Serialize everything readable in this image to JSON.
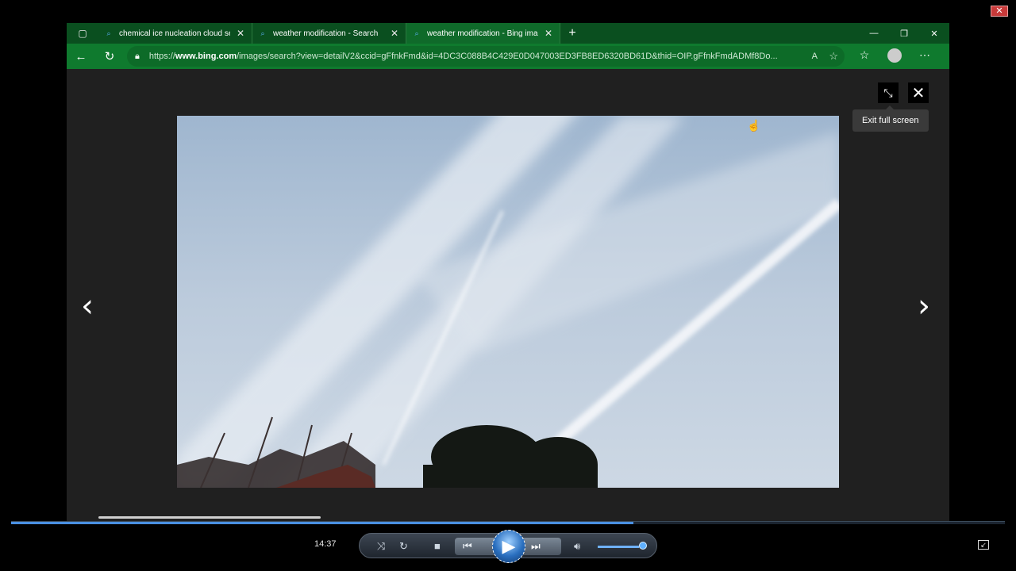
{
  "browser": {
    "tabs": [
      {
        "title": "chemical ice nucleation cloud se",
        "active": false
      },
      {
        "title": "weather modification - Search",
        "active": false
      },
      {
        "title": "weather modification - Bing ima",
        "active": true
      }
    ],
    "url_prefix": "https://",
    "url_domain": "www.bing.com",
    "url_rest": "/images/search?view=detailV2&ccid=gFfnkFmd&id=4DC3C088B4C429E0D047003ED3FB8ED6320BD61D&thid=OIP.gFfnkFmdADMf8Do...",
    "theme_color": "#0f7a2e"
  },
  "viewer": {
    "tooltip": "Exit full screen",
    "exit_fullscreen_icon": "collapse-icon",
    "close_icon": "close-icon",
    "image_subject": "contrails-sky-photo"
  },
  "player": {
    "time": "14:37",
    "progress_fraction": 0.626,
    "volume_fraction": 0.9,
    "accent_color": "#4a90e2"
  }
}
